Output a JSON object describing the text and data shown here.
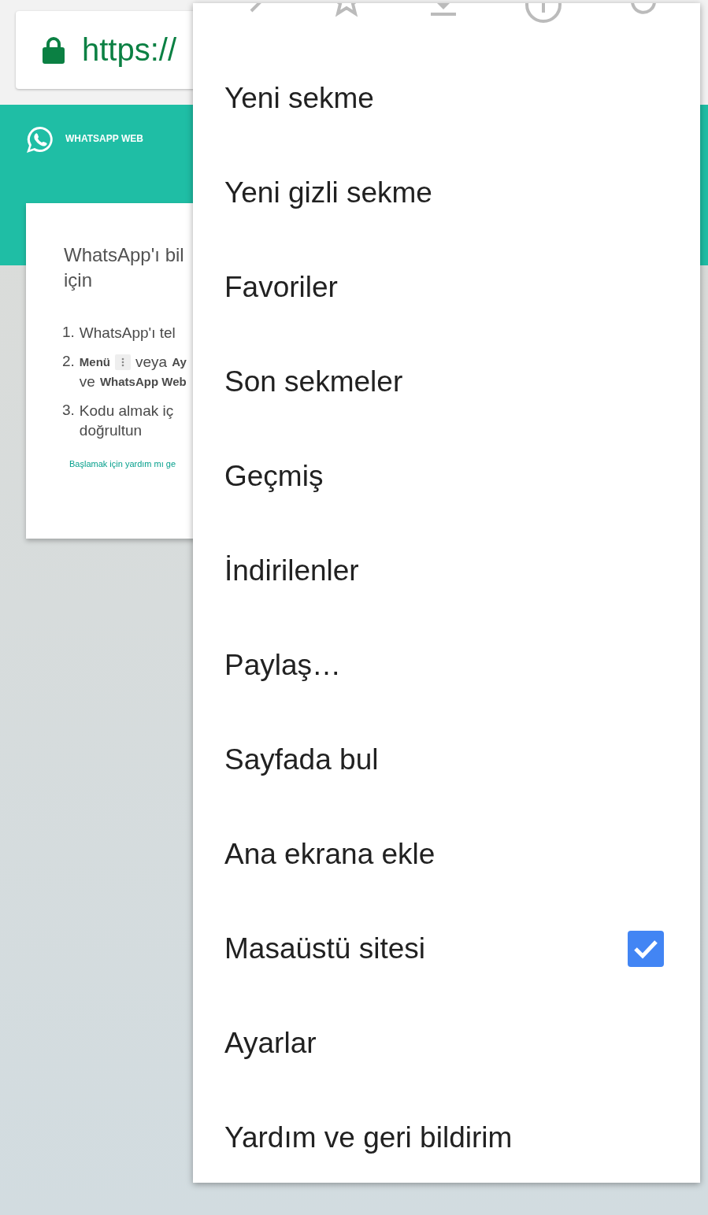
{
  "address_bar": {
    "url": "https://"
  },
  "header": {
    "title": "WHATSAPP WEB"
  },
  "card": {
    "title_lines": [
      "WhatsApp'ı bil",
      "için"
    ],
    "steps": [
      {
        "number": "1.",
        "lines": [
          [
            {
              "kind": "text",
              "text": "WhatsApp'ı tel"
            }
          ]
        ]
      },
      {
        "number": "2.",
        "lines": [
          [
            {
              "kind": "bold",
              "text": "Menü"
            },
            {
              "kind": "menu_key"
            },
            {
              "kind": "text",
              "text": "veya"
            },
            {
              "kind": "bold",
              "text": "Ay"
            }
          ],
          [
            {
              "kind": "text",
              "text": "ve"
            },
            {
              "kind": "bold",
              "text": "WhatsApp Web"
            }
          ]
        ]
      },
      {
        "number": "3.",
        "lines": [
          [
            {
              "kind": "text",
              "text": "Kodu almak iç"
            }
          ],
          [
            {
              "kind": "text",
              "text": "doğrultun"
            }
          ]
        ]
      }
    ],
    "help_link": "Başlamak için yardım mı ge"
  },
  "menu": {
    "toolbar": [
      {
        "kind": "forward"
      },
      {
        "kind": "star"
      },
      {
        "kind": "download"
      },
      {
        "kind": "info"
      },
      {
        "kind": "refresh"
      }
    ],
    "items": [
      {
        "label": "Yeni sekme",
        "kind": "plain"
      },
      {
        "label": "Yeni gizli sekme",
        "kind": "plain"
      },
      {
        "label": "Favoriler",
        "kind": "plain"
      },
      {
        "label": "Son sekmeler",
        "kind": "plain"
      },
      {
        "label": "Geçmiş",
        "kind": "plain"
      },
      {
        "label": "İndirilenler",
        "kind": "plain"
      },
      {
        "label": "Paylaş…",
        "kind": "plain"
      },
      {
        "label": "Sayfada bul",
        "kind": "plain"
      },
      {
        "label": "Ana ekrana ekle",
        "kind": "plain"
      },
      {
        "label": "Masaüstü sitesi",
        "kind": "checkbox",
        "checked": true
      },
      {
        "label": "Ayarlar",
        "kind": "plain"
      },
      {
        "label": "Yardım ve geri bildirim",
        "kind": "plain"
      }
    ]
  }
}
